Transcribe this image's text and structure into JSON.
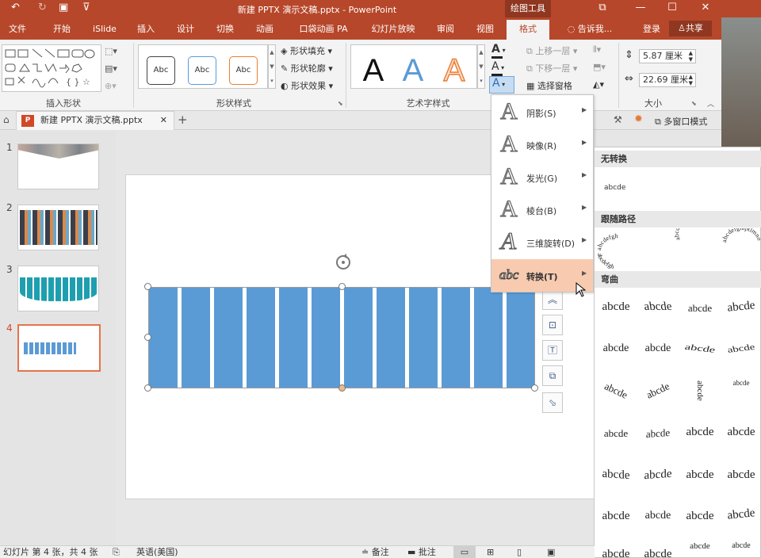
{
  "title_bar": {
    "title": "新建 PPTX 演示文稿.pptx - PowerPoint",
    "context_tab": "绘图工具",
    "quick_access": {
      "undo": "↶",
      "redo": "↻",
      "save": "▣",
      "customize": "⊽"
    },
    "window_buttons": {
      "restore_ribbon": "⧉",
      "minimize": "—",
      "maximize": "☐",
      "close": "✕"
    }
  },
  "ribbon_tabs": {
    "items": [
      "文件",
      "开始",
      "iSlide",
      "插入",
      "设计",
      "切换",
      "动画",
      "口袋动画 PA",
      "幻灯片放映",
      "审阅",
      "视图",
      "格式"
    ],
    "active": "格式",
    "tell_me": "告诉我...",
    "login": "登录",
    "share": "共享"
  },
  "ribbon": {
    "insert_shapes": {
      "label": "插入形状"
    },
    "shape_styles": {
      "label": "形状样式",
      "sample": "Abc",
      "fill": "形状填充",
      "outline": "形状轮廓",
      "effects": "形状效果"
    },
    "wordart": {
      "label": "艺术字样式",
      "sample": "A"
    },
    "arrange": {
      "bring_forward": "上移一层",
      "send_backward": "下移一层",
      "selection_pane": "选择窗格"
    },
    "size": {
      "label": "大小",
      "height": "5.87 厘米",
      "width": "22.69 厘米"
    }
  },
  "doc_tab": {
    "name": "新建 PPTX 演示文稿.pptx",
    "close": "✕",
    "add": "+",
    "multiwindow": "多窗口模式"
  },
  "thumbnails": {
    "numbers": [
      "1",
      "2",
      "3",
      "4"
    ],
    "selected": 4
  },
  "text_effects_menu": {
    "items": [
      {
        "label": "阴影(S)"
      },
      {
        "label": "映像(R)"
      },
      {
        "label": "发光(G)"
      },
      {
        "label": "棱台(B)"
      },
      {
        "label": "三维旋转(D)"
      },
      {
        "label": "转换(T)",
        "highlighted": true
      }
    ],
    "icon_letter": "A",
    "transform_icon": "abc"
  },
  "transform_submenu": {
    "no_transform": "无转换",
    "no_transform_sample": "abcde",
    "follow_path": "跟随路径",
    "path_samples": [
      "abcdefgh",
      "abcdefghijklm",
      "abcdefghijklmno"
    ],
    "warp": "弯曲",
    "warp_sample": "abcde"
  },
  "status_bar": {
    "slide_info": "幻灯片 第 4 张，共 4 张",
    "language": "英语(美国)",
    "notes": "备注",
    "comments": "批注"
  },
  "colors": {
    "accent": "#b7472a",
    "shape_fill": "#5b9bd5",
    "menu_highlight": "#f8cbb0"
  }
}
